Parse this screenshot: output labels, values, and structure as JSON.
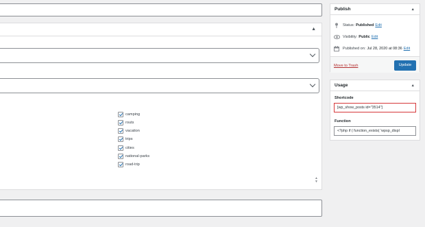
{
  "publish": {
    "title": "Publish",
    "status_label": "Status:",
    "status_value": "Published",
    "status_edit": "Edit",
    "visibility_label": "Visibility:",
    "visibility_value": "Public",
    "visibility_edit": "Edit",
    "published_label": "Published on:",
    "published_value": "Jul 28, 2020 at 08:36",
    "published_edit": "Edit",
    "trash_link": "Move to Trash",
    "update_button": "Update"
  },
  "usage": {
    "title": "Usage",
    "shortcode_label": "Shortcode",
    "shortcode_value": "[wp_show_posts id=\"3514\"]",
    "function_label": "Function",
    "function_value": "<?php if ( function_exists( 'wpsp_displ"
  },
  "tags": [
    {
      "label": "camping",
      "checked": true
    },
    {
      "label": "routs",
      "checked": true
    },
    {
      "label": "vacation",
      "checked": true
    },
    {
      "label": "trips",
      "checked": true
    },
    {
      "label": "cities",
      "checked": true
    },
    {
      "label": "national-parks",
      "checked": true
    },
    {
      "label": "road-trip",
      "checked": true
    }
  ],
  "icons": {
    "collapse": "triangle-up-icon",
    "status": "pin-icon",
    "visibility": "eye-icon",
    "published": "calendar-icon",
    "select": "chevron-down-icon"
  },
  "colors": {
    "accent": "#2271b1",
    "danger": "#b32d2e",
    "highlight_border": "#d63638"
  }
}
